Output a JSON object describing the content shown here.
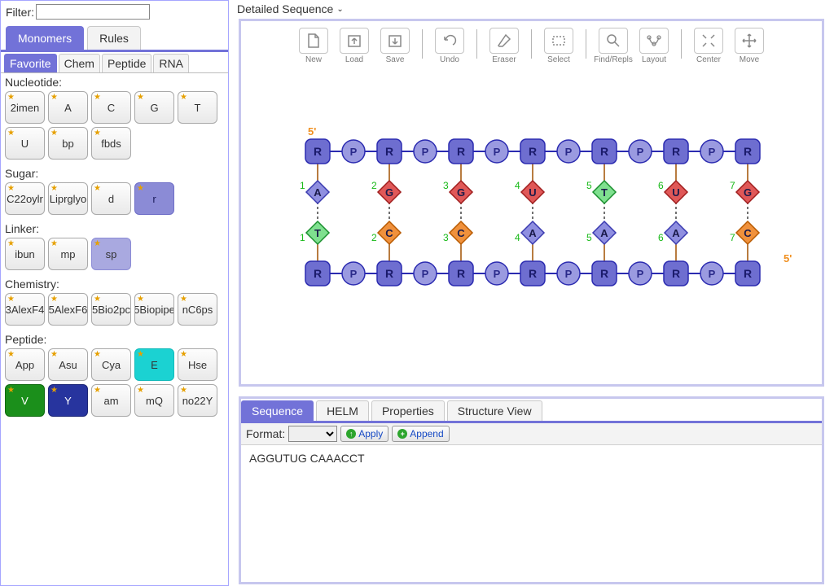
{
  "filter": {
    "label": "Filter:",
    "value": ""
  },
  "tabsL1": {
    "monomers": "Monomers",
    "rules": "Rules"
  },
  "tabsL2": {
    "favorite": "Favorite",
    "chem": "Chem",
    "peptide": "Peptide",
    "rna": "RNA"
  },
  "groups": {
    "nucleotide": {
      "label": "Nucleotide:",
      "items": [
        "2imen",
        "A",
        "C",
        "G",
        "T",
        "U",
        "bp",
        "fbds"
      ]
    },
    "sugar": {
      "label": "Sugar:",
      "items": [
        "C22oylr",
        "Liprglyo",
        "d",
        "r"
      ]
    },
    "linker": {
      "label": "Linker:",
      "items": [
        "ibun",
        "mp",
        "sp"
      ]
    },
    "chemistry": {
      "label": "Chemistry:",
      "items": [
        "3AlexF4",
        "5AlexF6",
        "5Bio2pc",
        "5Biopipe",
        "nC6ps"
      ]
    },
    "peptide": {
      "label": "Peptide:",
      "items": [
        "App",
        "Asu",
        "Cya",
        "E",
        "Hse",
        "V",
        "Y",
        "am",
        "mQ",
        "no22Y"
      ]
    }
  },
  "detailedHeader": "Detailed Sequence",
  "toolbar": {
    "new": "New",
    "load": "Load",
    "save": "Save",
    "undo": "Undo",
    "eraser": "Eraser",
    "select": "Select",
    "findrepl": "Find/Repls",
    "layout": "Layout",
    "center": "Center",
    "move": "Move"
  },
  "canvas": {
    "fivePrimeTop": "5'",
    "fivePrimeBottom": "5'",
    "R": "R",
    "P": "P",
    "topBases": [
      "A",
      "G",
      "G",
      "U",
      "T",
      "U",
      "G"
    ],
    "bottomBases": [
      "T",
      "C",
      "C",
      "A",
      "A",
      "A",
      "C"
    ],
    "numbers": [
      "1",
      "2",
      "3",
      "4",
      "5",
      "6",
      "7"
    ]
  },
  "bottom": {
    "tabs": {
      "sequence": "Sequence",
      "helm": "HELM",
      "properties": "Properties",
      "structure": "Structure View"
    },
    "formatLabel": "Format:",
    "apply": "Apply",
    "append": "Append",
    "sequenceText": "AGGUTUG CAAACCT"
  }
}
